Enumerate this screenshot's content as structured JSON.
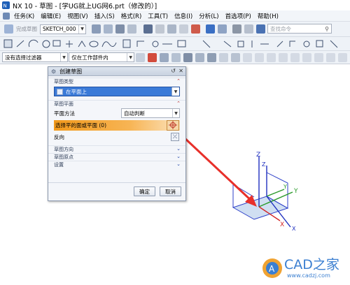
{
  "window": {
    "title": "NX 10 - 草图 - [学UG就上UG网6.prt（修改的）]"
  },
  "menu": [
    "任务(K)",
    "编辑(E)",
    "视图(V)",
    "插入(S)",
    "格式(R)",
    "工具(T)",
    "信息(I)",
    "分析(L)",
    "首选项(P)",
    "帮助(H)"
  ],
  "toolbar": {
    "finish_sketch": "完成草图",
    "sketch_name": "SKETCH_000",
    "search_placeholder": "查找命令",
    "filter": "没有选择过滤器",
    "scope": "仅在工作部件内"
  },
  "dialog": {
    "title": "创建草图",
    "sec_type": "草图类型",
    "type_value": "在平面上",
    "sec_plane": "草图平面",
    "plane_method_label": "平面方法",
    "plane_method_value": "自动判断",
    "select_plane": "选择平的面或平面 (0)",
    "reverse": "反向",
    "sec_direction": "草图方向",
    "sec_origin": "草图原点",
    "sec_settings": "设置",
    "ok": "确定",
    "cancel": "取消"
  },
  "triad": {
    "z_main": "Z",
    "z_small": "Z",
    "y_main": "Y",
    "y_small": "Y",
    "x_main": "X",
    "x_small": "X"
  },
  "watermark": {
    "text": "CAD之家",
    "url": "www.cadzj.com"
  },
  "colors": {
    "accent": "#3a7ad8",
    "selection": "#f29a1c",
    "arrow": "#e8302a",
    "watermark": "#3b7fd1"
  }
}
